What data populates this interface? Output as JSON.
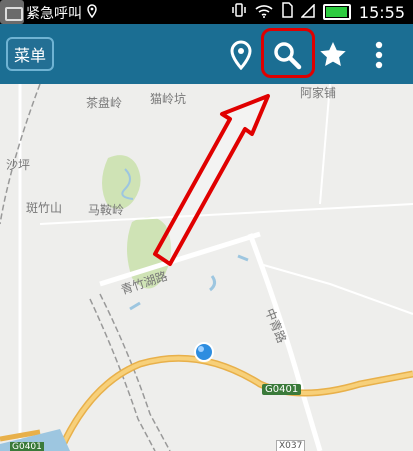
{
  "status_bar": {
    "left_text": "紧急呼叫",
    "time": "15:55"
  },
  "toolbar": {
    "menu_label": "菜单",
    "icons": [
      "location-pin-icon",
      "search-icon",
      "star-icon",
      "overflow-menu-icon"
    ]
  },
  "map": {
    "labels": {
      "chapanling": "茶盘岭",
      "maolingkeng": "猫岭坑",
      "shaping": "沙坪",
      "banzhushan": "斑竹山",
      "maanling": "马鞍岭",
      "qingzhuhu_road": "青竹湖路",
      "zhongqing_road": "中青路",
      "top_right": "阿家铺",
      "road_badge": "G0401",
      "road_badge_bottom": "X037",
      "bottom_left": "G0401"
    }
  },
  "annotation": {
    "highlight_color": "#e00000"
  }
}
